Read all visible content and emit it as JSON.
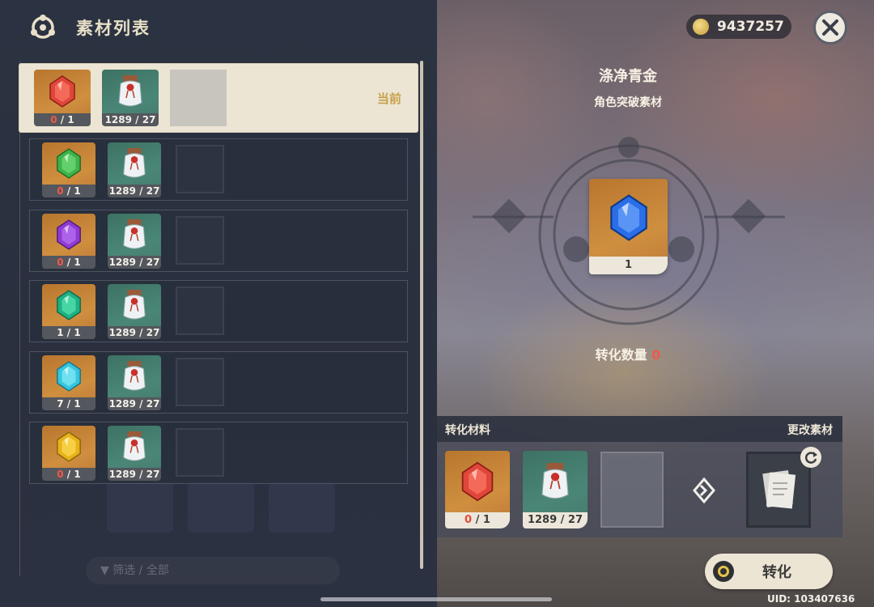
{
  "header": {
    "title": "素材列表",
    "icon": "crafting-menu-icon"
  },
  "rows": [
    {
      "gem": "red-gem",
      "gem_color": "#e0463a",
      "gem_owned": "0",
      "gem_need": " / 1",
      "bottle": "1289 / 27"
    },
    {
      "gem": "green-gem",
      "gem_color": "#3fb24a",
      "gem_owned": "0",
      "gem_need": " / 1",
      "bottle": "1289 / 27"
    },
    {
      "gem": "purple-gem",
      "gem_color": "#8f3bd1",
      "gem_owned": "0",
      "gem_need": " / 1",
      "bottle": "1289 / 27"
    },
    {
      "gem": "emerald-gem",
      "gem_color": "#1fb183",
      "gem_owned": "1 / 1",
      "gem_need": "",
      "bottle": "1289 / 27"
    },
    {
      "gem": "cyan-gem",
      "gem_color": "#35c6de",
      "gem_owned": "7 / 1",
      "gem_need": "",
      "bottle": "1289 / 27"
    },
    {
      "gem": "yellow-gem",
      "gem_color": "#e8b21b",
      "gem_owned": "0",
      "gem_need": " / 1",
      "bottle": "1289 / 27"
    }
  ],
  "current_label": "当前",
  "filter": {
    "label": "筛选 / 全部"
  },
  "coins": {
    "value": "9437257"
  },
  "target": {
    "name": "涤净青金",
    "type": "角色突破素材",
    "count": "1",
    "gem_color": "#2b6ee8"
  },
  "convert_count": {
    "label": "转化数量 ",
    "value": "0"
  },
  "materials": {
    "header_left": "转化材料",
    "header_right": "更改素材",
    "gem_owned": "0",
    "gem_need": " / 1",
    "bottle": "1289 / 27"
  },
  "convert_button": {
    "label": "转化"
  },
  "uid": "UID: 103407636"
}
